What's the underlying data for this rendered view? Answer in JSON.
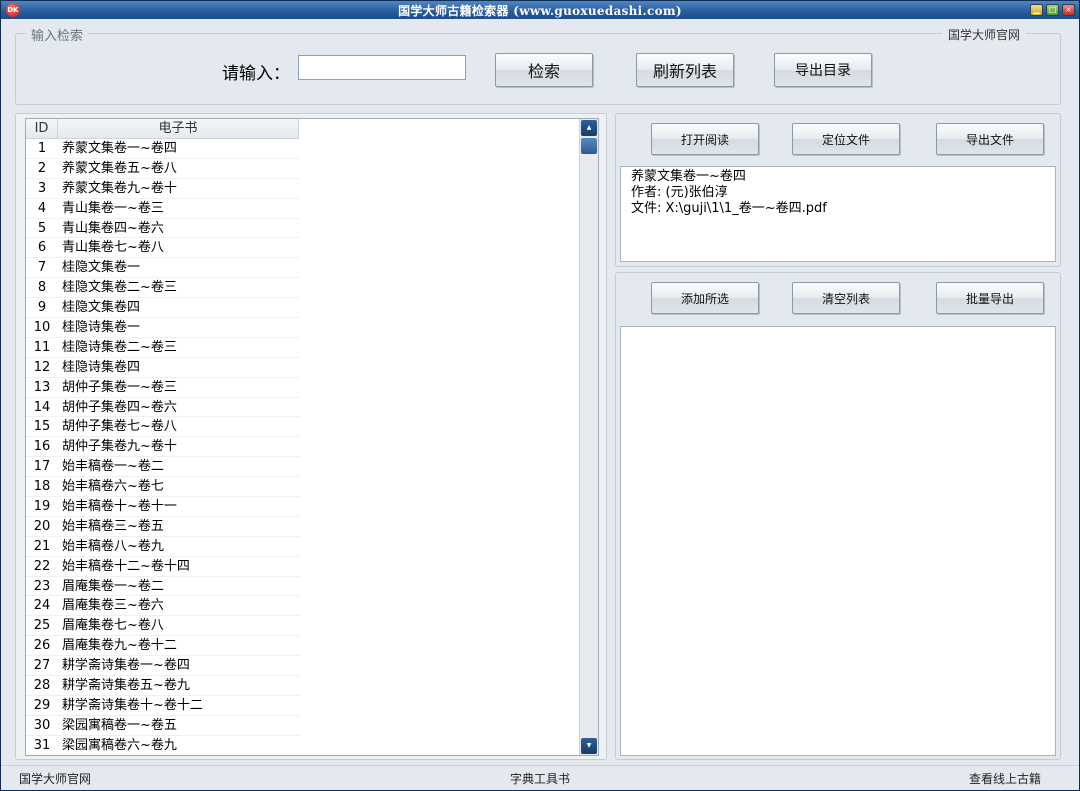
{
  "window": {
    "title": "国学大师古籍检索器 (www.guoxuedashi.com)",
    "app_icon": "DK",
    "minimize_icon": "▁",
    "maximize_icon": "□",
    "close_icon": "×"
  },
  "search_group": {
    "legend": "输入检索",
    "official_site": "国学大师官网",
    "input_label": "请输入：",
    "input_value": "",
    "search_button": "检索",
    "refresh_button": "刷新列表",
    "export_catalog_button": "导出目录"
  },
  "book_list": {
    "columns": [
      "ID",
      "电子书"
    ],
    "rows": [
      [
        "1",
        "养蒙文集卷一~卷四"
      ],
      [
        "2",
        "养蒙文集卷五~卷八"
      ],
      [
        "3",
        "养蒙文集卷九~卷十"
      ],
      [
        "4",
        "青山集卷一~卷三"
      ],
      [
        "5",
        "青山集卷四~卷六"
      ],
      [
        "6",
        "青山集卷七~卷八"
      ],
      [
        "7",
        "桂隐文集卷一"
      ],
      [
        "8",
        "桂隐文集卷二~卷三"
      ],
      [
        "9",
        "桂隐文集卷四"
      ],
      [
        "10",
        "桂隐诗集卷一"
      ],
      [
        "11",
        "桂隐诗集卷二~卷三"
      ],
      [
        "12",
        "桂隐诗集卷四"
      ],
      [
        "13",
        "胡仲子集卷一~卷三"
      ],
      [
        "14",
        "胡仲子集卷四~卷六"
      ],
      [
        "15",
        "胡仲子集卷七~卷八"
      ],
      [
        "16",
        "胡仲子集卷九~卷十"
      ],
      [
        "17",
        "始丰稿卷一~卷二"
      ],
      [
        "18",
        "始丰稿卷六~卷七"
      ],
      [
        "19",
        "始丰稿卷十~卷十一"
      ],
      [
        "20",
        "始丰稿卷三~卷五"
      ],
      [
        "21",
        "始丰稿卷八~卷九"
      ],
      [
        "22",
        "始丰稿卷十二~卷十四"
      ],
      [
        "23",
        "眉庵集卷一~卷二"
      ],
      [
        "24",
        "眉庵集卷三~卷六"
      ],
      [
        "25",
        "眉庵集卷七~卷八"
      ],
      [
        "26",
        "眉庵集卷九~卷十二"
      ],
      [
        "27",
        "耕学斋诗集卷一~卷四"
      ],
      [
        "28",
        "耕学斋诗集卷五~卷九"
      ],
      [
        "29",
        "耕学斋诗集卷十~卷十二"
      ],
      [
        "30",
        "梁园寓稿卷一~卷五"
      ],
      [
        "31",
        "梁园寓稿卷六~卷九"
      ]
    ],
    "scroll_up_icon": "▲",
    "scroll_down_icon": "▼"
  },
  "file_actions": {
    "open_read": "打开阅读",
    "locate_file": "定位文件",
    "export_file": "导出文件"
  },
  "file_info": {
    "title": "养蒙文集卷一~卷四",
    "author": "作者: (元)张伯淳",
    "file": "文件: X:\\guji\\1\\1_卷一~卷四.pdf"
  },
  "batch_actions": {
    "add_selected": "添加所选",
    "clear_list": "清空列表",
    "batch_export": "批量导出"
  },
  "statusbar": {
    "left": "国学大师官网",
    "center": "字典工具书",
    "right": "查看线上古籍"
  }
}
